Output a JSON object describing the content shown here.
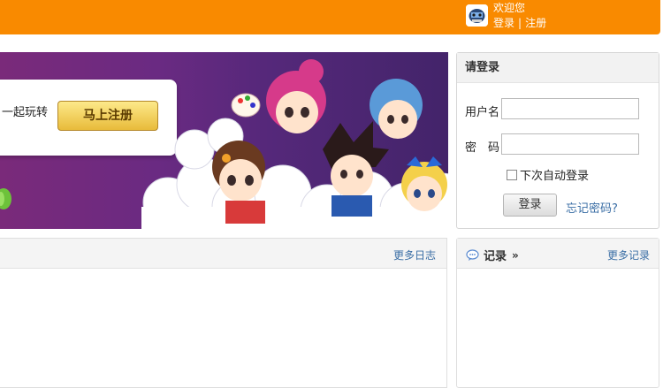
{
  "header": {
    "welcome": "欢迎您",
    "login_link": "登录",
    "separator": "|",
    "register_link": "注册",
    "bg_color": "#f98a00"
  },
  "banner": {
    "text": "一起玩转",
    "register_button": "马上注册",
    "bg_color": "#6a2a82"
  },
  "login_panel": {
    "title": "请登录",
    "username_label": "用户名",
    "password_label": "密　码",
    "remember_label": "下次自动登录",
    "login_button": "登录",
    "forgot_link": "忘记密码?"
  },
  "blog_panel": {
    "more_link": "更多日志"
  },
  "records_panel": {
    "title": "记录",
    "chevron": "»",
    "more_link": "更多记录"
  }
}
